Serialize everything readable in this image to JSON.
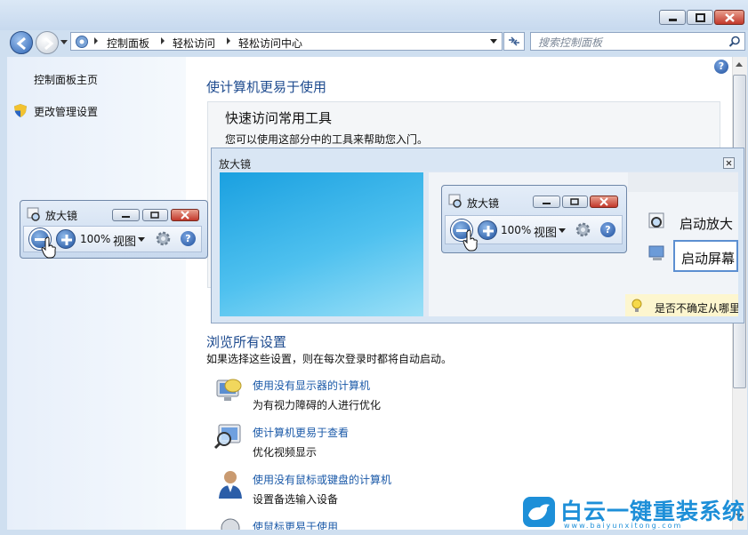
{
  "window": {
    "buttons": {
      "minimize": "minimize",
      "maximize": "maximize",
      "close": "close"
    }
  },
  "navbar": {
    "breadcrumbs": [
      "控制面板",
      "轻松访问",
      "轻松访问中心"
    ],
    "search_placeholder": "搜索控制面板"
  },
  "left_pane": {
    "items": [
      {
        "label": "控制面板主页"
      },
      {
        "label": "更改管理设置",
        "icon": "shield-icon"
      }
    ]
  },
  "main": {
    "title": "使计算机更易于使用",
    "quick_access": {
      "heading": "快速访问常用工具",
      "description": "您可以使用这部分中的工具来帮助您入门。"
    },
    "browse": {
      "heading": "浏览所有设置",
      "description": "如果选择这些设置，则在每次登录时都将自动启动。",
      "items": [
        {
          "link": "使用没有显示器的计算机",
          "desc": "为有视力障碍的人进行优化",
          "icon": "display-speaker-icon"
        },
        {
          "link": "使计算机更易于查看",
          "desc": "优化视频显示",
          "icon": "magnify-screen-icon"
        },
        {
          "link": "使用没有鼠标或键盘的计算机",
          "desc": "设置备选输入设备",
          "icon": "user-icon"
        },
        {
          "link": "使鼠标更易于使用",
          "desc": "",
          "icon": "mouse-icon"
        }
      ]
    }
  },
  "magnifier_lens": {
    "title": "放大镜",
    "right_items": [
      "启动放大",
      "启动屏幕"
    ],
    "hint": "是否不确定从哪里"
  },
  "magnifier_toolbar": {
    "title": "放大镜",
    "zoom": "100%",
    "view": "视图"
  },
  "watermark": {
    "text": "白云一键重装系统",
    "sub": "www.baiyunxitong.com"
  },
  "colors": {
    "link": "#1a59a8",
    "heading": "#1e4b8f",
    "watermark": "#1d8fd8"
  }
}
